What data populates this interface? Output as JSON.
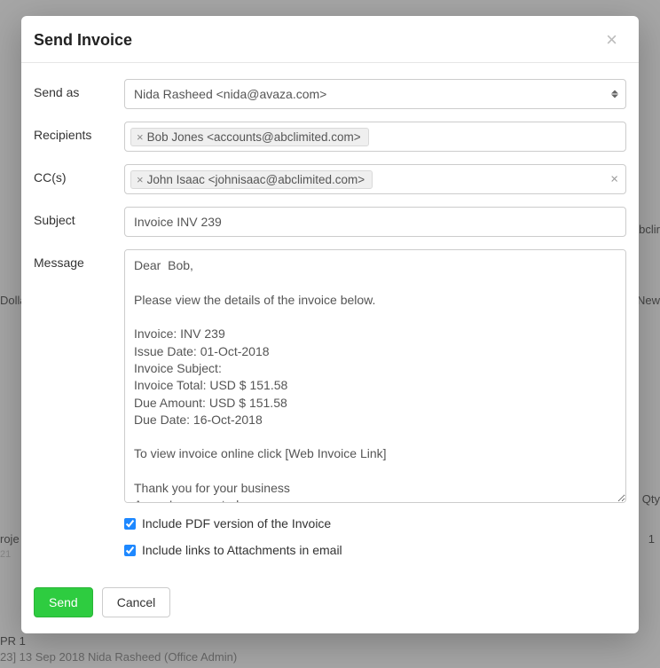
{
  "modal": {
    "title": "Send Invoice",
    "close_symbol": "×"
  },
  "labels": {
    "send_as": "Send as",
    "recipients": "Recipients",
    "cc": "CC(s)",
    "subject": "Subject",
    "message": "Message"
  },
  "form": {
    "send_as": "Nida Rasheed <nida@avaza.com>",
    "recipients": [
      {
        "display": "Bob Jones <accounts@abclimited.com>"
      }
    ],
    "cc": [
      {
        "display": "John Isaac <johnisaac@abclimited.com>"
      }
    ],
    "subject": "Invoice INV 239",
    "message": "Dear  Bob,\n\nPlease view the details of the invoice below.\n\nInvoice: INV 239\nIssue Date: 01-Oct-2018\nInvoice Subject:\nInvoice Total: USD $ 151.58\nDue Amount: USD $ 151.58\nDue Date: 16-Oct-2018\n\nTo view invoice online click [Web Invoice Link]\n\nThank you for your business\nAcme Incorporated",
    "include_pdf": {
      "checked": true,
      "label": "Include PDF version of the Invoice"
    },
    "include_attachments": {
      "checked": true,
      "label": "Include links to Attachments in email"
    }
  },
  "footer": {
    "send_label": "Send",
    "cancel_label": "Cancel"
  },
  "bg_fragments": {
    "dolla": "Dolla",
    "abclir": "abclir",
    "new": "New",
    "qty": "Qty",
    "roje": "roje",
    "row_21": "21",
    "num_1": "1",
    "pr1": "PR 1",
    "bottom_line": "23] 13 Sep 2018   Nida Rasheed   (Office Admin)"
  }
}
